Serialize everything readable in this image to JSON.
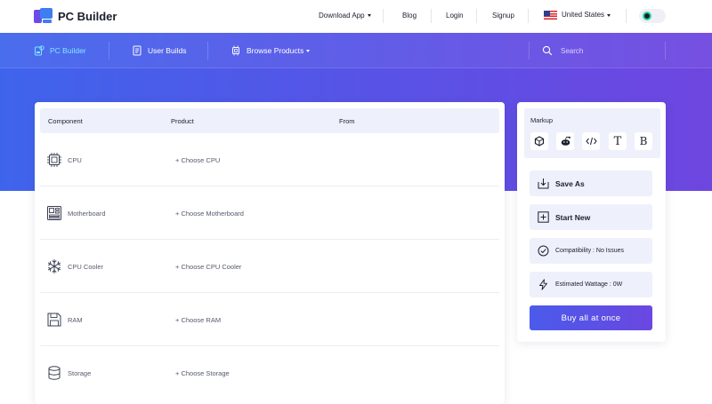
{
  "brand": {
    "name": "PC Builder"
  },
  "topnav": {
    "download": "Download App",
    "blog": "Blog",
    "login": "Login",
    "signup": "Signup",
    "country": "United States"
  },
  "subnav": {
    "pc_builder": "PC Builder",
    "user_builds": "User Builds",
    "browse_products": "Browse Products",
    "search_placeholder": "Search"
  },
  "table": {
    "headers": {
      "component": "Component",
      "product": "Product",
      "from": "From"
    },
    "rows": [
      {
        "component": "CPU",
        "action": "+ Choose CPU",
        "icon": "cpu-icon"
      },
      {
        "component": "Motherboard",
        "action": "+ Choose Motherboard",
        "icon": "motherboard-icon"
      },
      {
        "component": "CPU Cooler",
        "action": "+ Choose CPU Cooler",
        "icon": "snowflake-icon"
      },
      {
        "component": "RAM",
        "action": "+ Choose RAM",
        "icon": "ram-icon"
      },
      {
        "component": "Storage",
        "action": "+ Choose Storage",
        "icon": "storage-icon"
      }
    ]
  },
  "sidebar": {
    "markup_title": "Markup",
    "markup_buttons": [
      "T",
      "B"
    ],
    "save_as": "Save As",
    "start_new": "Start New",
    "compatibility": "Compatibility : No Issues",
    "wattage": "Estimated Wattage : 0W",
    "buy_all": "Buy all at once"
  },
  "colors": {
    "accent": "#5a52e6",
    "active_tab": "#7fe7ff",
    "toggle_ring": "#2fd5a3"
  }
}
